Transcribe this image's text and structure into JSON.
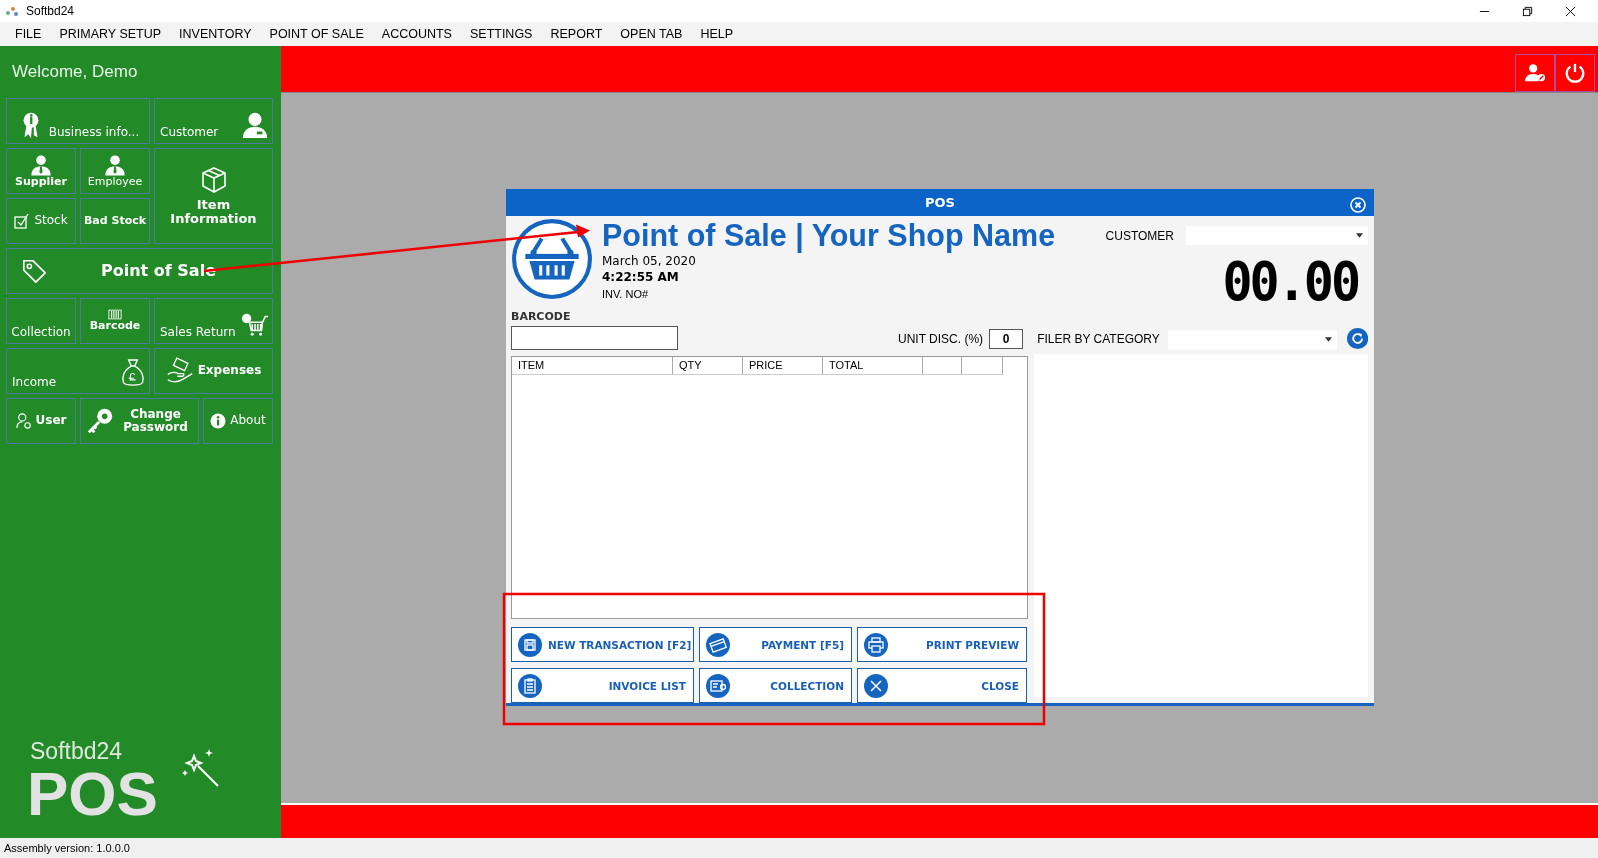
{
  "window": {
    "title": "Softbd24"
  },
  "menu": [
    "FILE",
    "PRIMARY SETUP",
    "INVENTORY",
    "POINT OF SALE",
    "ACCOUNTS",
    "SETTINGS",
    "REPORT",
    "OPEN TAB",
    "HELP"
  ],
  "sidebar": {
    "welcome": "Welcome, Demo",
    "tiles": [
      "Business info...",
      "Customer",
      "Supplier",
      "Employee",
      "Stock",
      "Bad Stock",
      "Item Information",
      "Point of Sale",
      "Collection",
      "Barcode",
      "Sales Return",
      "Income",
      "Expenses",
      "User",
      "Change Password",
      "About"
    ],
    "brand": "Softbd24",
    "product": "POS"
  },
  "pos_window": {
    "title": "POS",
    "heading": "Point of Sale | Your Shop Name",
    "date": "March 05, 2020",
    "time": "4:22:55 AM",
    "invoice_label": "INV. NO#",
    "customer_label": "CUSTOMER",
    "total": "00.00",
    "barcode_label": "BARCODE",
    "unit_disc_label": "UNIT DISC. (%)",
    "unit_disc_value": "0",
    "category_label": "FILER BY CATEGORY",
    "table": {
      "columns": [
        "ITEM",
        "QTY",
        "PRICE",
        "TOTAL"
      ]
    },
    "buttons": [
      "NEW TRANSACTION [F2]",
      "PAYMENT [F5]",
      "PRINT PREVIEW",
      "INVOICE LIST",
      "COLLECTION",
      "CLOSE"
    ]
  },
  "status_bar": "Assembly version: 1.0.0.0"
}
